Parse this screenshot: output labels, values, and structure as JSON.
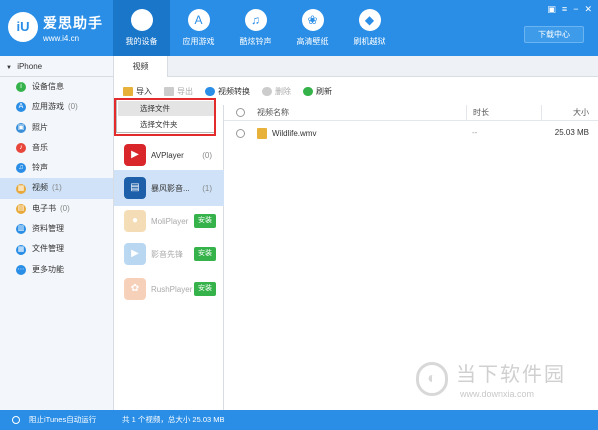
{
  "app": {
    "brand_name": "爱思助手",
    "brand_url": "www.i4.cn",
    "logo_text": "iU",
    "download_center": "下载中心"
  },
  "nav": [
    {
      "label": "我的设备",
      "icon": "apple-icon",
      "glyph": ""
    },
    {
      "label": "应用游戏",
      "icon": "app-store-icon",
      "glyph": "A"
    },
    {
      "label": "酷炫铃声",
      "icon": "music-icon",
      "glyph": "♫"
    },
    {
      "label": "高清壁纸",
      "icon": "wallpaper-icon",
      "glyph": "❀"
    },
    {
      "label": "刷机越狱",
      "icon": "dropbox-icon",
      "glyph": "◆"
    }
  ],
  "sidebar": {
    "device": "iPhone",
    "items": [
      {
        "label": "设备信息",
        "count": "",
        "color": "#35b34a",
        "icon": "info-icon"
      },
      {
        "label": "应用游戏",
        "count": "(0)",
        "color": "#2a8ee6",
        "icon": "apps-icon"
      },
      {
        "label": "照片",
        "count": "",
        "color": "#3a8fd9",
        "icon": "photo-icon"
      },
      {
        "label": "音乐",
        "count": "",
        "color": "#e8463a",
        "icon": "music-icon"
      },
      {
        "label": "铃声",
        "count": "",
        "color": "#2a8ee6",
        "icon": "bell-icon"
      },
      {
        "label": "视频",
        "count": "(1)",
        "color": "#e8a93a",
        "icon": "video-icon"
      },
      {
        "label": "电子书",
        "count": "(0)",
        "color": "#e8a93a",
        "icon": "book-icon"
      },
      {
        "label": "资料管理",
        "count": "",
        "color": "#2a8ee6",
        "icon": "contacts-icon"
      },
      {
        "label": "文件管理",
        "count": "",
        "color": "#2a8ee6",
        "icon": "folder-icon"
      },
      {
        "label": "更多功能",
        "count": "",
        "color": "#2a8ee6",
        "icon": "more-icon"
      }
    ]
  },
  "tab": "视频",
  "toolbar": {
    "import": "导入",
    "export": "导出",
    "convert": "视频转换",
    "delete": "删除",
    "refresh": "刷新"
  },
  "dropdown": {
    "items": [
      "选择文件",
      "选择文件夹"
    ]
  },
  "apps": [
    {
      "name": "AVPlayer",
      "count": "(0)",
      "color": "#d9262b",
      "glyph": "▶"
    },
    {
      "name": "暴风影音...",
      "count": "(1)",
      "color": "#1d5fa8",
      "glyph": "▤"
    },
    {
      "name": "MoliPlayer",
      "install": "安装",
      "color": "#e0a030",
      "glyph": "●"
    },
    {
      "name": "影音先锋",
      "install": "安装",
      "color": "#3a8fd9",
      "glyph": "▶"
    },
    {
      "name": "RushPlayer",
      "install": "安装",
      "color": "#e87a3a",
      "glyph": "✿"
    }
  ],
  "table": {
    "headers": {
      "name": "视频名称",
      "duration": "时长",
      "size": "大小"
    },
    "rows": [
      {
        "name": "Wildlife.wmv",
        "duration": "--",
        "size": "25.03 MB"
      }
    ]
  },
  "status": {
    "itunes": "阻止iTunes自动运行",
    "summary": "共 1 个视频，总大小 25.03 MB"
  },
  "watermark": {
    "title": "当下软件园",
    "url": "www.downxia.com"
  },
  "colors": {
    "primary": "#2a8ee6",
    "selected": "#cfe2f7",
    "install": "#35b34a",
    "highlight": "#e32b2b"
  }
}
